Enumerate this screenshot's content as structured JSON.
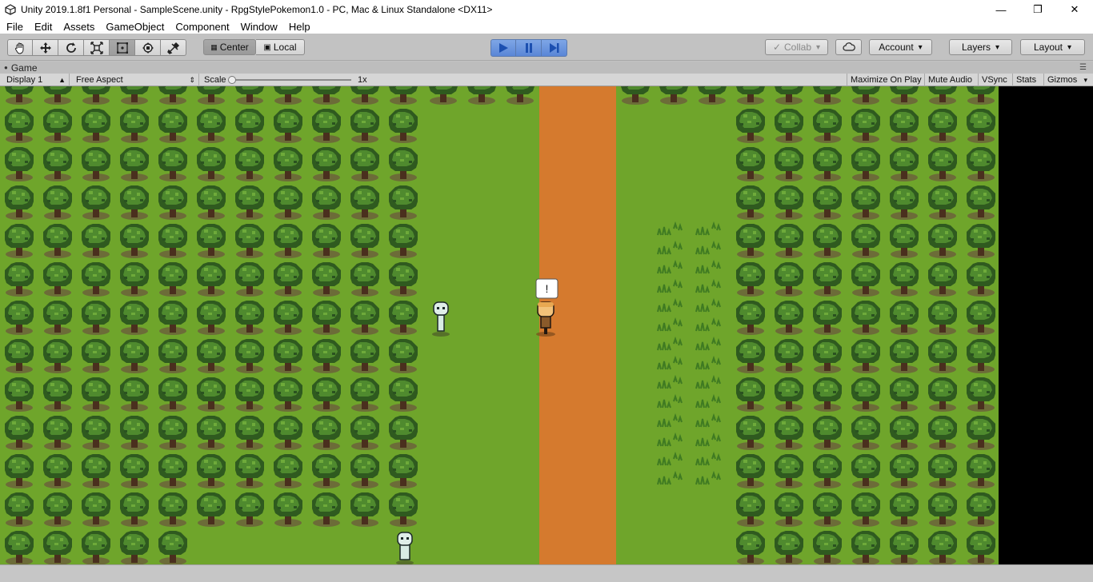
{
  "window": {
    "title": "Unity 2019.1.8f1 Personal - SampleScene.unity - RpgStylePokemon1.0 - PC, Mac & Linux Standalone <DX11>",
    "controls": [
      "minimize-icon",
      "restore-icon",
      "close-icon"
    ]
  },
  "menu": [
    "File",
    "Edit",
    "Assets",
    "GameObject",
    "Component",
    "Window",
    "Help"
  ],
  "toolbar": {
    "tools": [
      "hand-icon",
      "move-icon",
      "rotate-icon",
      "scale-icon",
      "rect-icon",
      "transform-icon",
      "custom-tool-icon"
    ],
    "pivot": "Center",
    "space": "Local",
    "collab": "Collab",
    "account": "Account",
    "layers": "Layers",
    "layout": "Layout"
  },
  "game_tab": {
    "title": "Game"
  },
  "game_bar": {
    "display": "Display 1",
    "aspect": "Free Aspect",
    "scale_label": "Scale",
    "scale_value": "1x",
    "maximize": "Maximize On Play",
    "mute": "Mute Audio",
    "vsync": "VSync",
    "stats": "Stats",
    "gizmos": "Gizmos"
  },
  "scene": {
    "exclaim": "!",
    "colors": {
      "grass": "#6fa52b",
      "path": "#d57a2e",
      "tree_dark": "#2f5a1f",
      "tree_light": "#5f9a33",
      "trunk": "#4a2f1e"
    }
  }
}
